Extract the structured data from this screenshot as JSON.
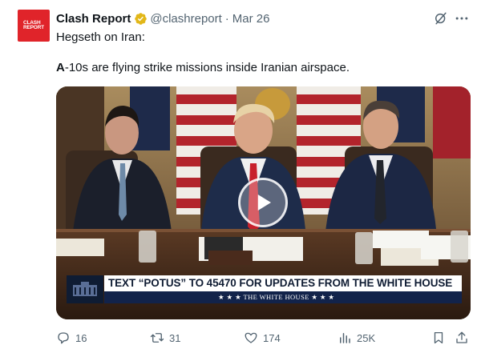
{
  "post": {
    "author_name": "Clash Report",
    "author_handle": "@clashreport",
    "separator": "·",
    "date": "Mar 26",
    "text_line_1": "Hegseth on Iran:",
    "text_line_2_bold": "A",
    "text_line_2_rest": "-10s are flying strike missions inside Iranian airspace."
  },
  "avatar": {
    "logo_text_1": "CLASH",
    "logo_text_2": "REPORT"
  },
  "media": {
    "banner_main": "TEXT “POTUS” TO 45470 FOR UPDATES FROM THE WHITE HOUSE",
    "banner_sub": "★ ★ ★  THE WHITE HOUSE  ★ ★ ★"
  },
  "actions": {
    "replies": "16",
    "reposts": "31",
    "likes": "174",
    "views": "25K"
  },
  "colors": {
    "accent_red": "#e0242a",
    "verified_gold": "#e2b719",
    "muted_text": "#536471"
  },
  "icons": [
    "verified-badge-icon",
    "grok-icon",
    "more-icon",
    "play-icon",
    "reply-icon",
    "repost-icon",
    "like-icon",
    "views-icon",
    "bookmark-icon",
    "share-icon"
  ]
}
